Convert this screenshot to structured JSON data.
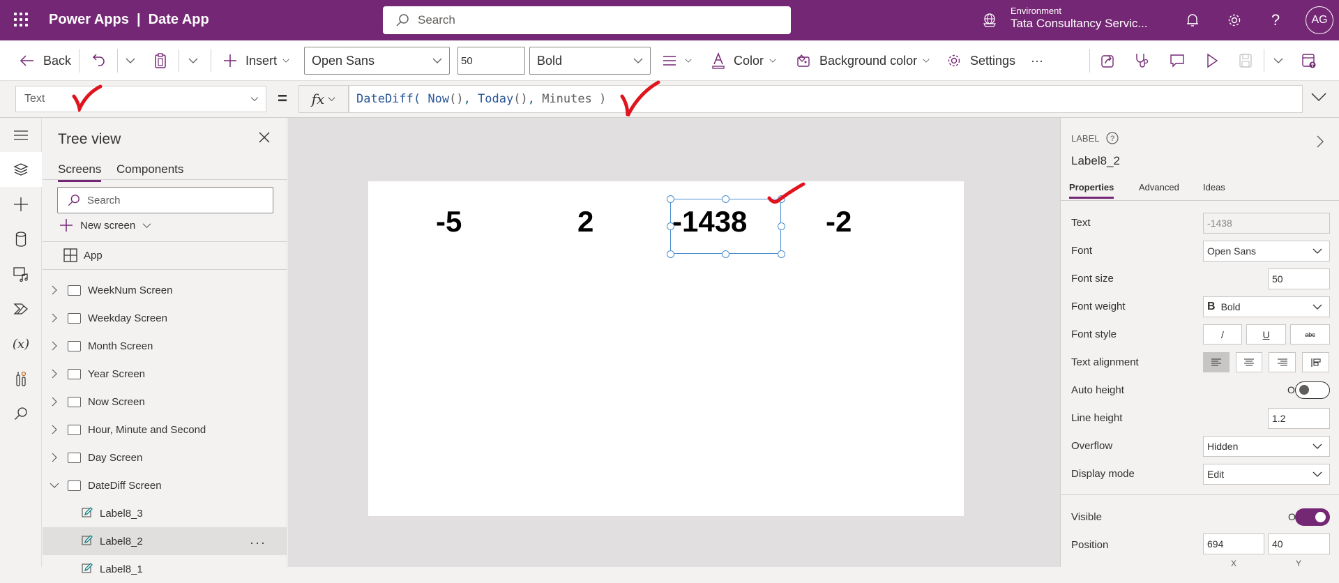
{
  "header": {
    "app_title": "Power Apps  |  Date App",
    "search_placeholder": "Search",
    "environment_label": "Environment",
    "environment_value": "Tata Consultancy Servic...",
    "avatar_initials": "AG",
    "icons": [
      "waffle-icon",
      "search-icon",
      "environment-icon",
      "bell-icon",
      "gear-icon",
      "help-icon"
    ]
  },
  "toolbar": {
    "back_label": "Back",
    "insert_label": "Insert",
    "font_value": "Open Sans",
    "font_size_value": "50",
    "font_weight_value": "Bold",
    "color_label": "Color",
    "background_color_label": "Background color",
    "settings_label": "Settings",
    "more_label": "···"
  },
  "formula_bar": {
    "property": "Text",
    "equals": "=",
    "fx_label": "fx",
    "formula_tokens": [
      {
        "t": "DateDiff( ",
        "c": "fn"
      },
      {
        "t": "Now",
        "c": "fn"
      },
      {
        "t": "()",
        "c": "p"
      },
      {
        "t": ", ",
        "c": "kw"
      },
      {
        "t": "Today",
        "c": "fn"
      },
      {
        "t": "()",
        "c": "p"
      },
      {
        "t": ", ",
        "c": "kw"
      },
      {
        "t": "Minutes )",
        "c": "p"
      }
    ]
  },
  "tree_view": {
    "title": "Tree view",
    "tabs": [
      "Screens",
      "Components"
    ],
    "active_tab": "Screens",
    "search_placeholder": "Search",
    "new_screen_label": "New screen",
    "app_label": "App",
    "items": [
      {
        "label": "WeekNum Screen",
        "type": "screen",
        "expanded": false
      },
      {
        "label": "Weekday Screen",
        "type": "screen",
        "expanded": false
      },
      {
        "label": "Month Screen",
        "type": "screen",
        "expanded": false
      },
      {
        "label": "Year Screen",
        "type": "screen",
        "expanded": false
      },
      {
        "label": "Now Screen",
        "type": "screen",
        "expanded": false
      },
      {
        "label": "Hour, Minute and Second",
        "type": "screen",
        "expanded": false
      },
      {
        "label": "Day Screen",
        "type": "screen",
        "expanded": false
      },
      {
        "label": "DateDiff Screen",
        "type": "screen",
        "expanded": true
      },
      {
        "label": "Label8_3",
        "type": "label",
        "selected": false
      },
      {
        "label": "Label8_2",
        "type": "label",
        "selected": true
      },
      {
        "label": "Label8_1",
        "type": "label",
        "selected": false
      }
    ],
    "more_label": "···"
  },
  "canvas": {
    "labels": [
      "-5",
      "2",
      "-1438",
      "-2"
    ],
    "selected_index": 2
  },
  "properties": {
    "control_type": "LABEL",
    "control_name": "Label8_2",
    "tabs": [
      "Properties",
      "Advanced",
      "Ideas"
    ],
    "active_tab": "Properties",
    "rows": {
      "text": {
        "label": "Text",
        "value": "-1438"
      },
      "font": {
        "label": "Font",
        "value": "Open Sans"
      },
      "font_size": {
        "label": "Font size",
        "value": "50"
      },
      "font_weight": {
        "label": "Font weight",
        "value": "Bold",
        "icon": "B"
      },
      "font_style": {
        "label": "Font style",
        "options": [
          "/",
          "U",
          "abc"
        ]
      },
      "text_alignment": {
        "label": "Text alignment",
        "selected": "left"
      },
      "auto_height": {
        "label": "Auto height",
        "state": "Off"
      },
      "line_height": {
        "label": "Line height",
        "value": "1.2"
      },
      "overflow": {
        "label": "Overflow",
        "value": "Hidden"
      },
      "display_mode": {
        "label": "Display mode",
        "value": "Edit"
      },
      "visible": {
        "label": "Visible",
        "state": "On"
      },
      "position": {
        "label": "Position",
        "x": "694",
        "y": "40",
        "x_caption": "X",
        "y_caption": "Y"
      }
    }
  },
  "colors": {
    "brand": "#742774",
    "annotation": "#e0141e",
    "selection": "#4a8ed0"
  }
}
